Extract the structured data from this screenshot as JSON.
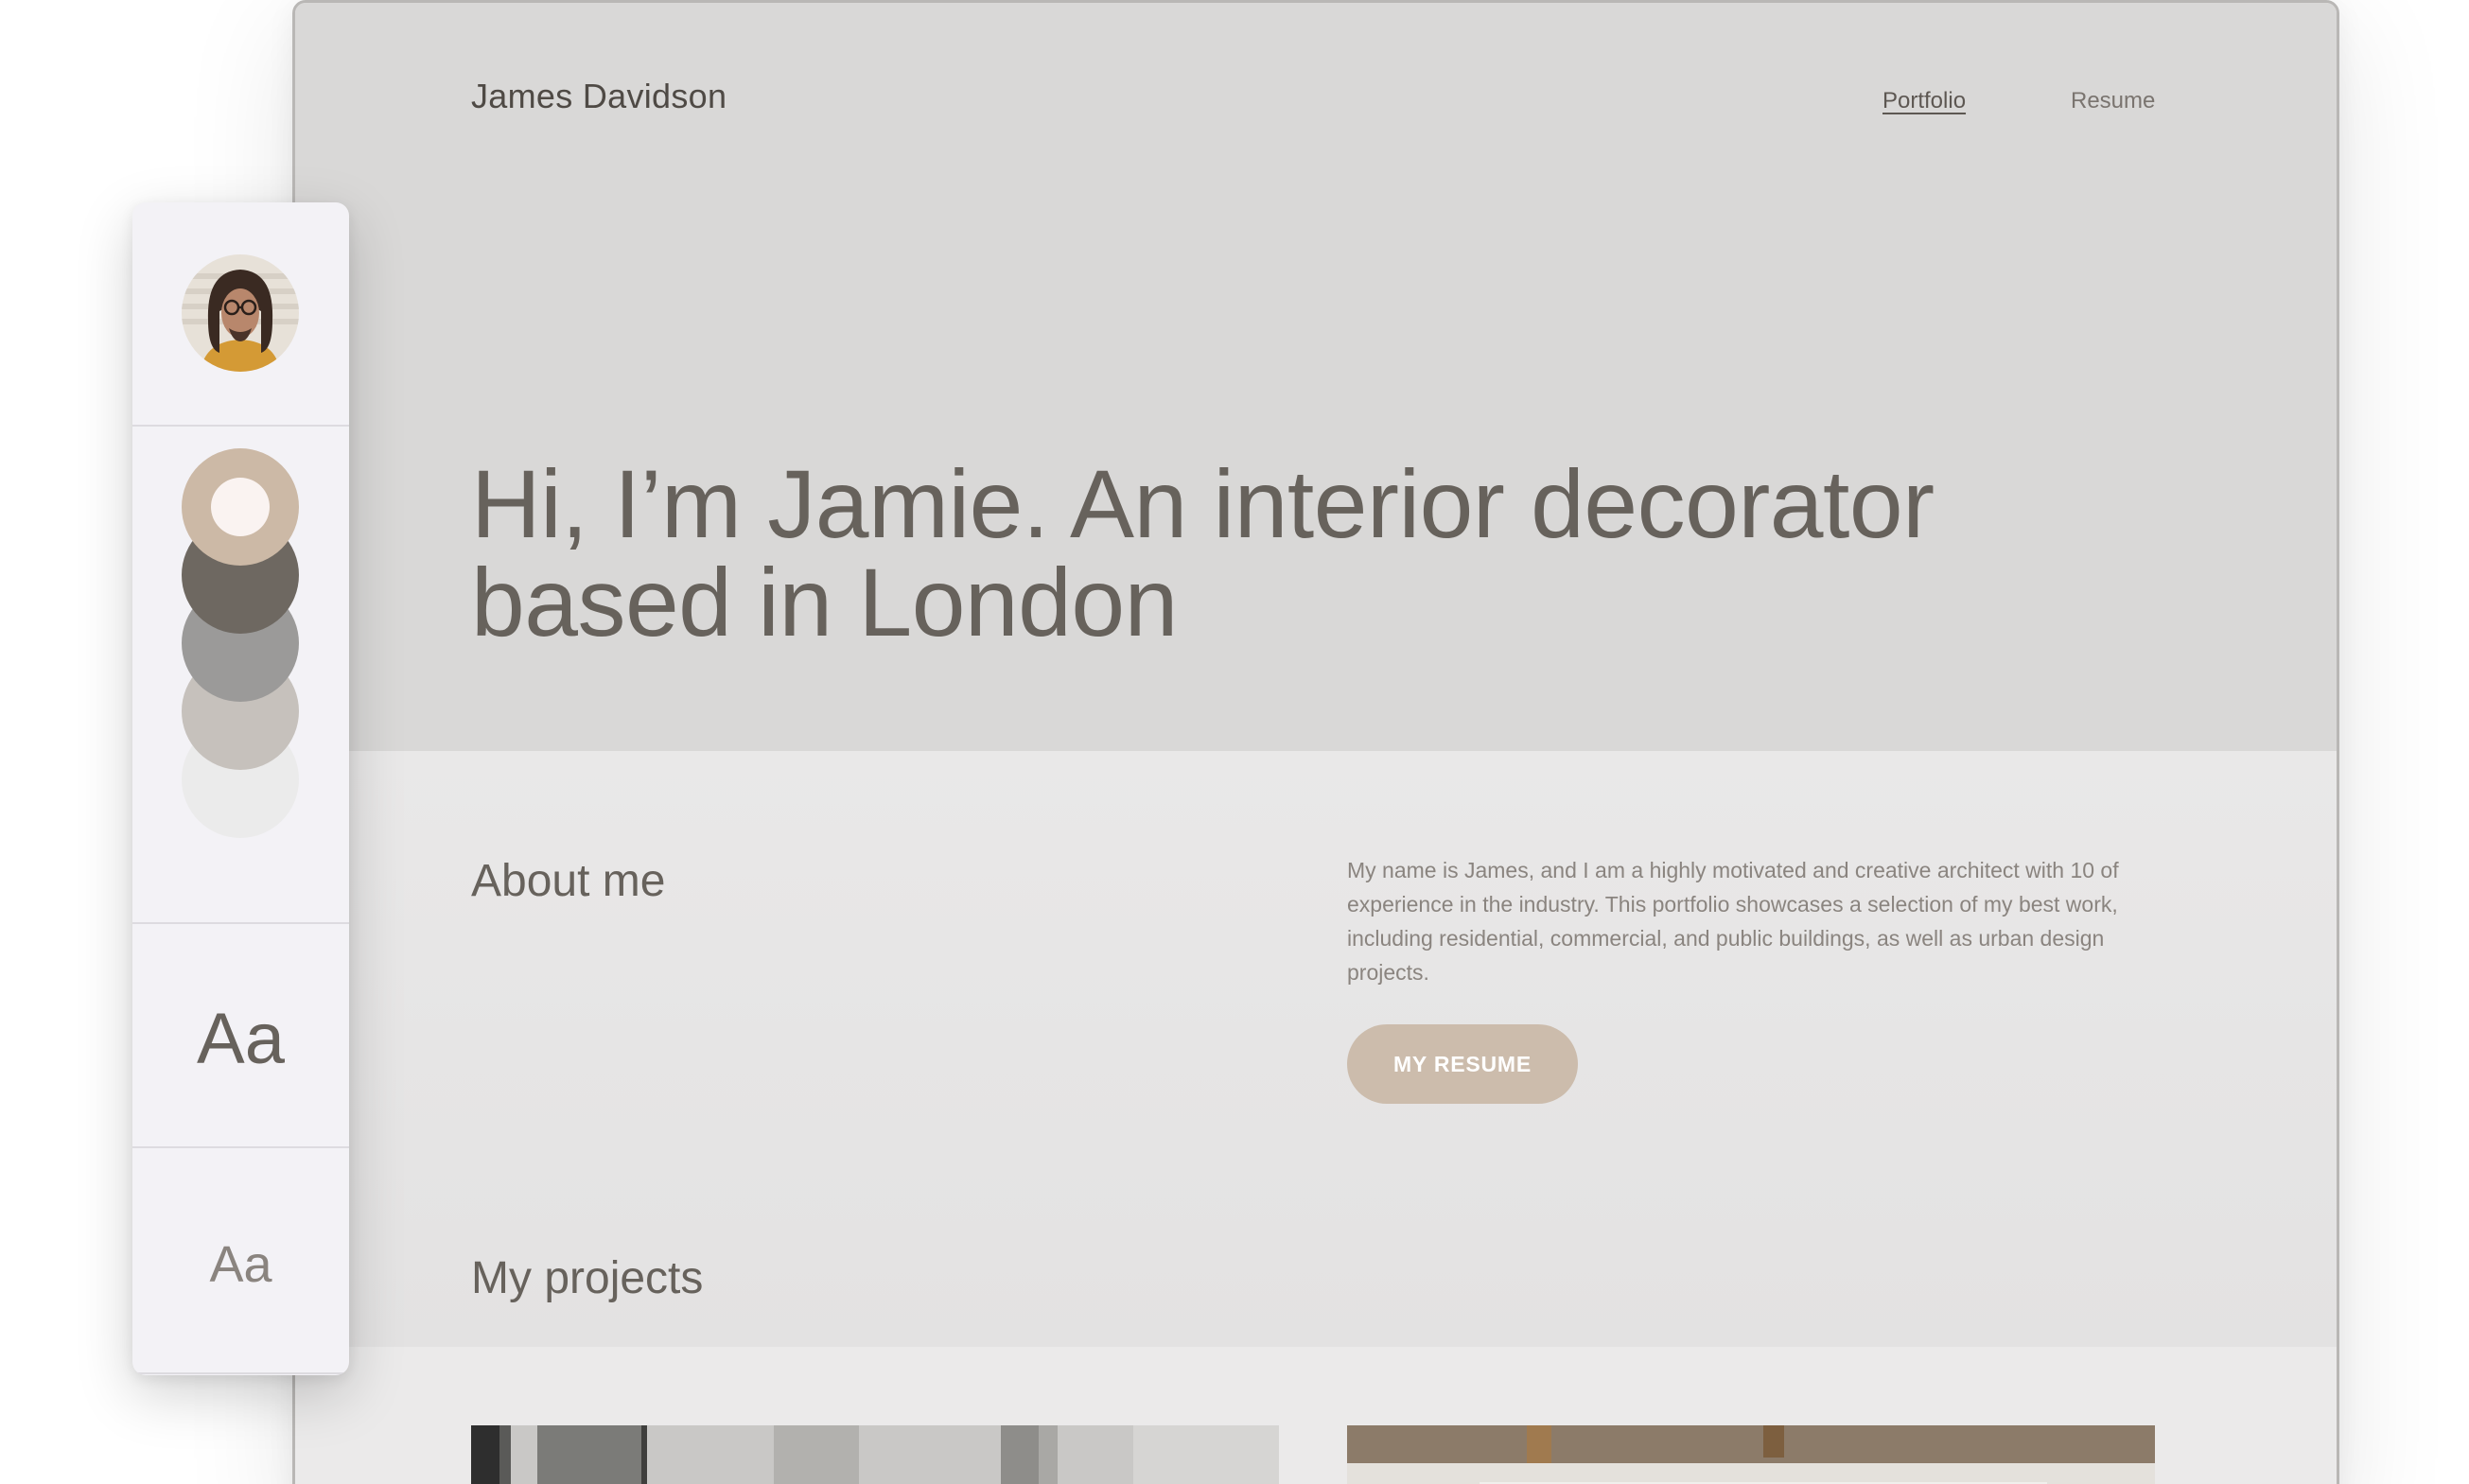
{
  "site": {
    "brand": "James Davidson",
    "nav": {
      "portfolio": "Portfolio",
      "resume": "Resume"
    },
    "hero": {
      "title_line1": "Hi, I’m Jamie. An interior decorator",
      "title_line2": "based in London"
    },
    "about": {
      "heading": "About me",
      "text": "My name is James, and I am a highly motivated and creative architect with 10 of experience in the industry. This portfolio showcases a selection of my best work, including residential, commercial, and public buildings, as well as urban design projects.",
      "button_label": "MY RESUME"
    },
    "projects": {
      "heading": "My projects"
    }
  },
  "theme_panel": {
    "swatches": [
      {
        "color": "#ccb9a6",
        "inner": "#faf3f1",
        "selected": true
      },
      {
        "color": "#6e6861"
      },
      {
        "color": "#9b9a99"
      },
      {
        "color": "#c6c1bc"
      },
      {
        "color": "#ebebeb"
      }
    ],
    "heading_font_sample": "Aa",
    "body_font_sample": "Aa"
  },
  "colors": {
    "accent": "#ccbcac",
    "hero_bg": "#d9d8d7",
    "text_primary": "#67625c"
  }
}
